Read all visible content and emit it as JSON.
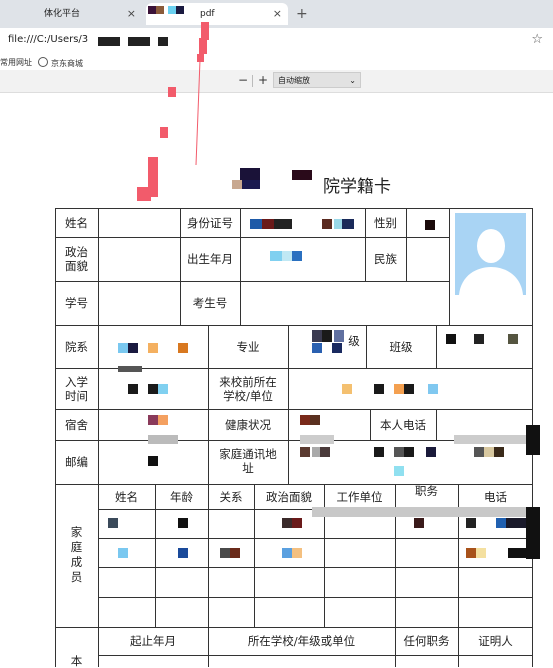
{
  "browser": {
    "tabs": [
      {
        "label": "体化平台",
        "close": "×"
      },
      {
        "label": "pdf",
        "close": "×"
      }
    ],
    "new_tab": "+",
    "url": "file:///C:/Users/3",
    "bookmarks": [
      "常用网址",
      "京东商城"
    ],
    "star": "☆"
  },
  "pdf_toolbar": {
    "zoom_out": "−",
    "zoom_in": "+",
    "zoom_value": "自动缩放",
    "chevron": "⌄"
  },
  "card": {
    "title": "院学籍卡",
    "labels": {
      "name": "姓名",
      "id_number": "身份证号",
      "gender": "性别",
      "politics": "政治\n面貌",
      "birth": "出生年月",
      "ethnicity": "民族",
      "student_no": "学号",
      "exam_no": "考生号",
      "department": "院系",
      "major": "专业",
      "major_suffix": "级",
      "class": "班级",
      "enroll_time": "入学\n时间",
      "origin_unit": "来校前所在\n学校/单位",
      "dorm": "宿舍",
      "health": "健康状况",
      "phone": "本人电话",
      "postcode": "邮编",
      "home_address": "家庭通讯地\n址",
      "family": "家\n庭\n成\n员",
      "fam_name": "姓名",
      "fam_age": "年龄",
      "fam_relation": "关系",
      "fam_politics": "政治面貌",
      "fam_work": "工作单位",
      "fam_post": "职务",
      "fam_phone": "电话",
      "period": "起止年月",
      "school_grade_unit": "所在学校/年级或单位",
      "position": "任何职务",
      "witness": "证明人",
      "self": "本"
    }
  },
  "colors": {
    "accent_arrow": "#f25b6b",
    "photo_bg": "#a9d4f4"
  }
}
